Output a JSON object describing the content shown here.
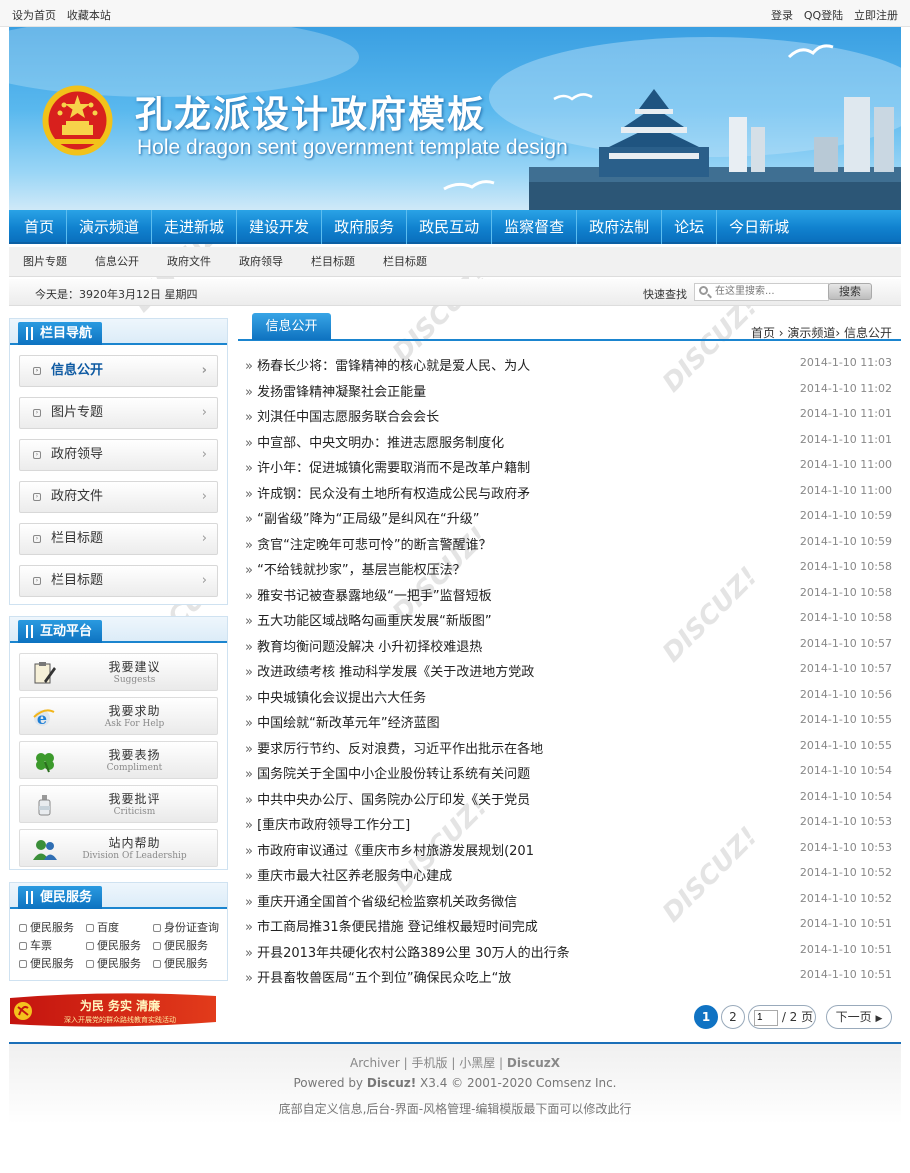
{
  "topbar": {
    "set_home": "设为首页",
    "favorite": "收藏本站",
    "login": "登录",
    "qq_login": "QQ登陆",
    "register": "立即注册"
  },
  "banner": {
    "title": "孔龙派设计政府模板",
    "subtitle": "Hole dragon sent government template design"
  },
  "main_nav": [
    "首页",
    "演示频道",
    "走进新城",
    "建设开发",
    "政府服务",
    "政民互动",
    "监察督查",
    "政府法制",
    "论坛",
    "今日新城"
  ],
  "sub_nav": [
    "图片专题",
    "信息公开",
    "政府文件",
    "政府领导",
    "栏目标题",
    "栏目标题"
  ],
  "datebar": {
    "date": "今天是：3920年3月12日 星期四",
    "quick_search": "快速查找",
    "search_placeholder": "在这里搜索...",
    "search_button": "搜索"
  },
  "sidebar": {
    "nav_title": "栏目导航",
    "nav_items": [
      "信息公开",
      "图片专题",
      "政府领导",
      "政府文件",
      "栏目标题",
      "栏目标题"
    ],
    "interact_title": "互动平台",
    "interact_items": [
      {
        "cn": "我要建议",
        "en": "Suggests",
        "icon": "clipboard-pencil-icon"
      },
      {
        "cn": "我要求助",
        "en": "Ask For Help",
        "icon": "ie-help-icon"
      },
      {
        "cn": "我要表扬",
        "en": "Compliment",
        "icon": "clover-icon"
      },
      {
        "cn": "我要批评",
        "en": "Criticism",
        "icon": "bottle-icon"
      },
      {
        "cn": "站内帮助",
        "en": "Division Of Leadership",
        "icon": "users-icon"
      }
    ],
    "service_title": "便民服务",
    "service_items": [
      "便民服务",
      "百度",
      "身份证查询",
      "车票",
      "便民服务",
      "便民服务",
      "便民服务",
      "便民服务",
      "便民服务"
    ]
  },
  "red_banner": {
    "line1": "为民 务实 清廉",
    "line2": "深入开展党的群众路线教育实践活动"
  },
  "content": {
    "tab": "信息公开",
    "breadcrumb": "首页 › 演示频道› 信息公开",
    "articles": [
      {
        "title": "杨春长少将：雷锋精神的核心就是爱人民、为人",
        "date": "2014-1-10 11:03"
      },
      {
        "title": "发扬雷锋精神凝聚社会正能量",
        "date": "2014-1-10 11:02"
      },
      {
        "title": "刘淇任中国志愿服务联合会会长",
        "date": "2014-1-10 11:01"
      },
      {
        "title": "中宣部、中央文明办：推进志愿服务制度化",
        "date": "2014-1-10 11:01"
      },
      {
        "title": "许小年：促进城镇化需要取消而不是改革户籍制",
        "date": "2014-1-10 11:00"
      },
      {
        "title": "许成钢：民众没有土地所有权造成公民与政府矛",
        "date": "2014-1-10 11:00"
      },
      {
        "title": "“副省级”降为“正局级”是纠风在“升级”",
        "date": "2014-1-10 10:59"
      },
      {
        "title": "贪官“注定晚年可悲可怜”的断言警醒谁？",
        "date": "2014-1-10 10:59"
      },
      {
        "title": "“不给钱就抄家”，基层岂能权压法？",
        "date": "2014-1-10 10:58"
      },
      {
        "title": "雅安书记被查暴露地级“一把手”监督短板",
        "date": "2014-1-10 10:58"
      },
      {
        "title": "五大功能区域战略勾画重庆发展“新版图”",
        "date": "2014-1-10 10:58"
      },
      {
        "title": "教育均衡问题没解决 小升初择校难退热",
        "date": "2014-1-10 10:57"
      },
      {
        "title": "改进政绩考核 推动科学发展《关于改进地方党政",
        "date": "2014-1-10 10:57"
      },
      {
        "title": "中央城镇化会议提出六大任务",
        "date": "2014-1-10 10:56"
      },
      {
        "title": "中国绘就“新改革元年”经济蓝图",
        "date": "2014-1-10 10:55"
      },
      {
        "title": "要求厉行节约、反对浪费，习近平作出批示在各地",
        "date": "2014-1-10 10:55"
      },
      {
        "title": "国务院关于全国中小企业股份转让系统有关问题",
        "date": "2014-1-10 10:54"
      },
      {
        "title": "中共中央办公厅、国务院办公厅印发《关于党员",
        "date": "2014-1-10 10:54"
      },
      {
        "title": "[重庆市政府领导工作分工]",
        "date": "2014-1-10 10:53"
      },
      {
        "title": "市政府审议通过《重庆市乡村旅游发展规划(201",
        "date": "2014-1-10 10:53"
      },
      {
        "title": "重庆市最大社区养老服务中心建成",
        "date": "2014-1-10 10:52"
      },
      {
        "title": "重庆开通全国首个省级纪检监察机关政务微信",
        "date": "2014-1-10 10:52"
      },
      {
        "title": "市工商局推31条便民措施 登记维权最短时间完成",
        "date": "2014-1-10 10:51"
      },
      {
        "title": "开县2013年共硬化农村公路389公里 30万人的出行条",
        "date": "2014-1-10 10:51"
      },
      {
        "title": "开县畜牧兽医局“五个到位”确保民众吃上“放",
        "date": "2014-1-10 10:51"
      }
    ]
  },
  "pager": {
    "page1": "1",
    "page2": "2",
    "current": "1",
    "total": " / 2 页",
    "next": "下一页"
  },
  "footer": {
    "links": [
      "Archiver",
      "手机版",
      "小黑屋",
      "DiscuzX"
    ],
    "powered_prefix": "Powered by ",
    "powered_brand": "Discuz!",
    "powered_suffix": " X3.4 © 2001-2020 Comsenz Inc.",
    "custom": "底部自定义信息,后台-界面-风格管理-编辑模版最下面可以修改此行"
  },
  "colors": {
    "primary": "#1182cf",
    "nav_dark": "#0a6fbd",
    "date_text": "#888888"
  }
}
